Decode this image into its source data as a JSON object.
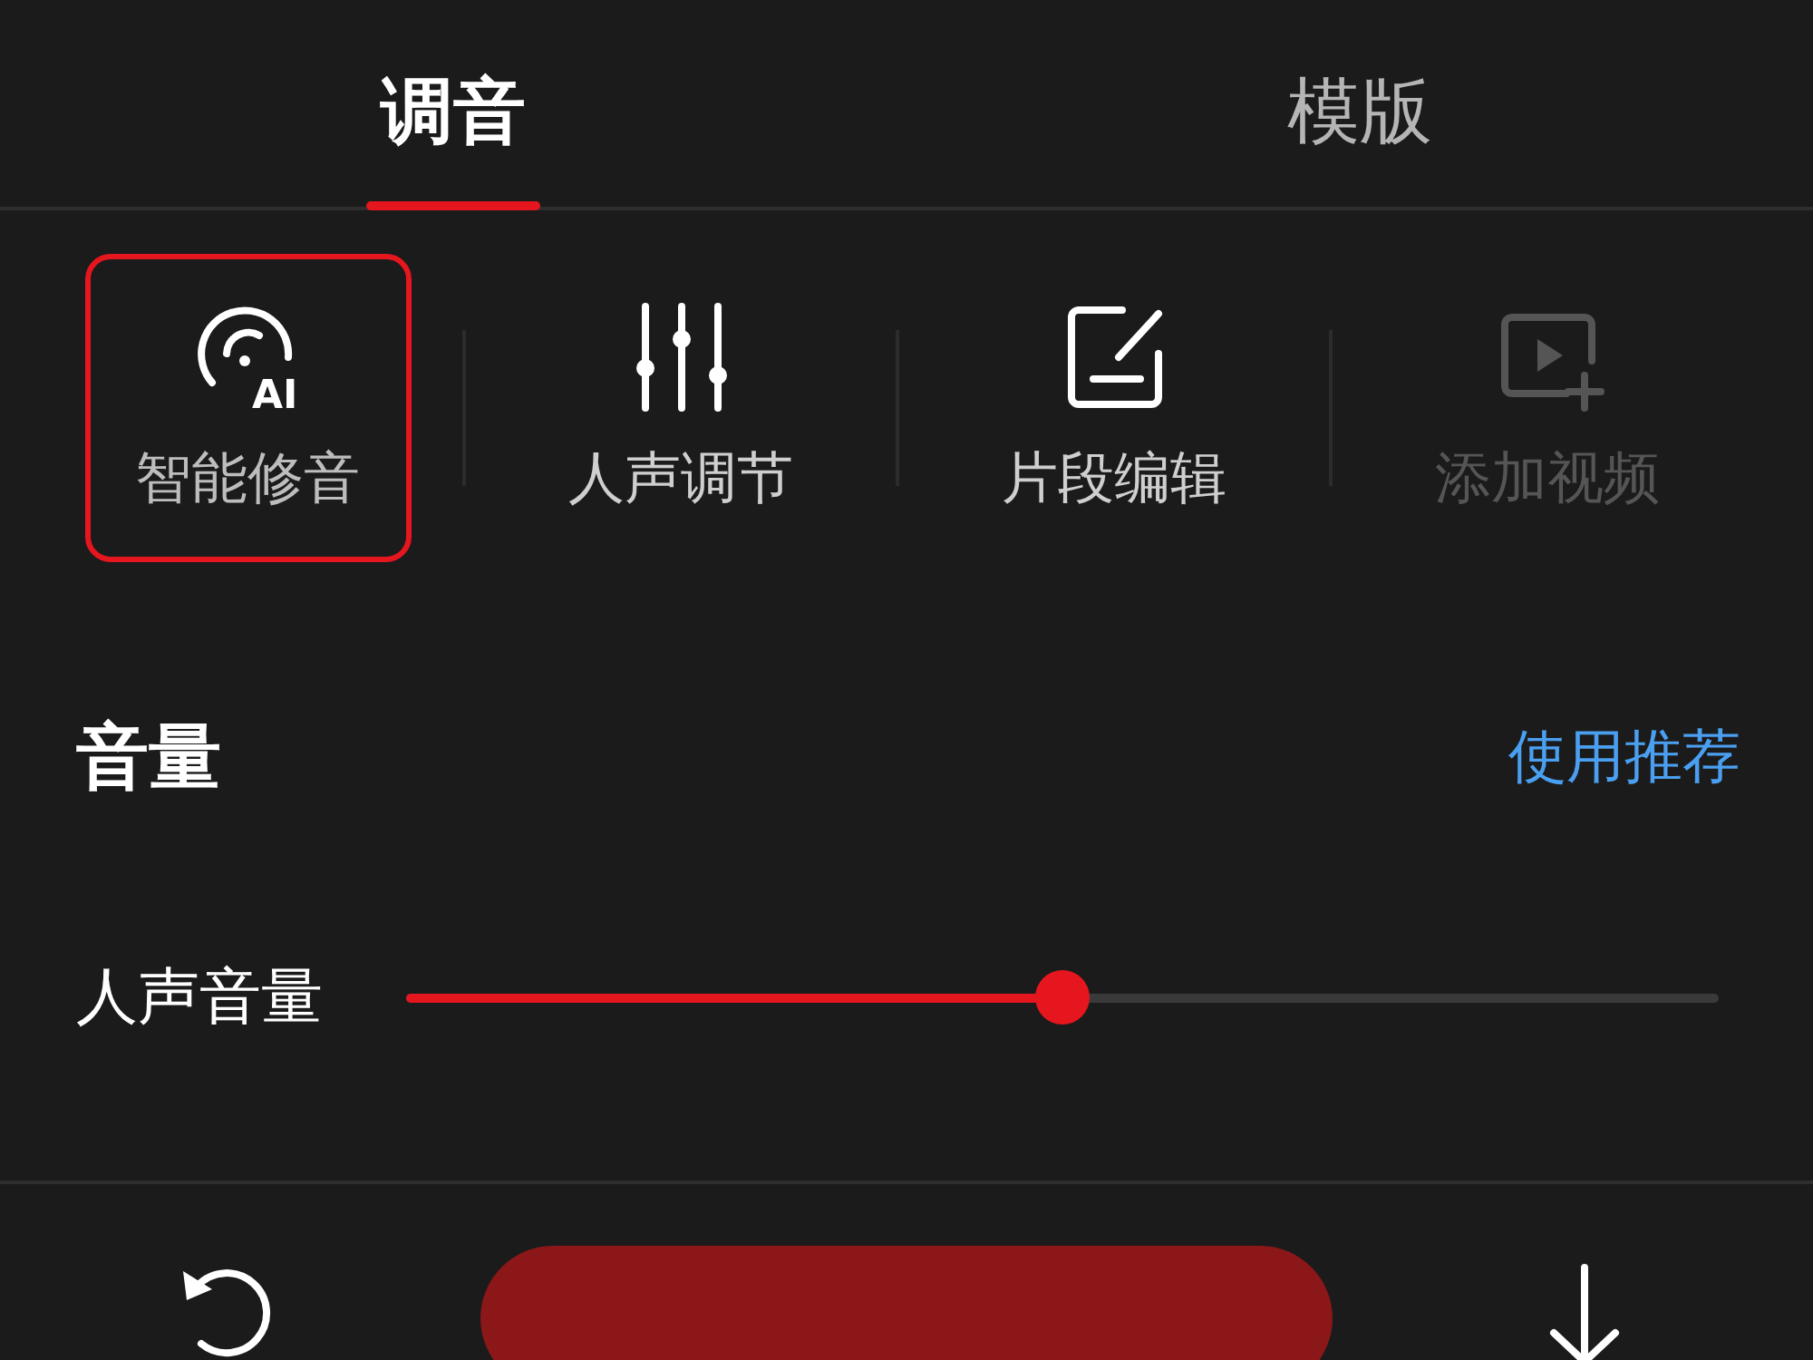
{
  "tabs": [
    {
      "label": "调音",
      "selected": true
    },
    {
      "label": "模版",
      "selected": false
    }
  ],
  "tools": [
    {
      "kind": "ai",
      "label": "智能修音",
      "icon_text": "AI",
      "selected": true,
      "disabled": false
    },
    {
      "kind": "sliders",
      "label": "人声调节",
      "selected": false,
      "disabled": false
    },
    {
      "kind": "edit",
      "label": "片段编辑",
      "selected": false,
      "disabled": false
    },
    {
      "kind": "video-add",
      "label": "添加视频",
      "selected": false,
      "disabled": true
    }
  ],
  "section": {
    "title": "音量",
    "action": "使用推荐"
  },
  "sliders": [
    {
      "label": "人声音量",
      "level": 0.5
    }
  ]
}
